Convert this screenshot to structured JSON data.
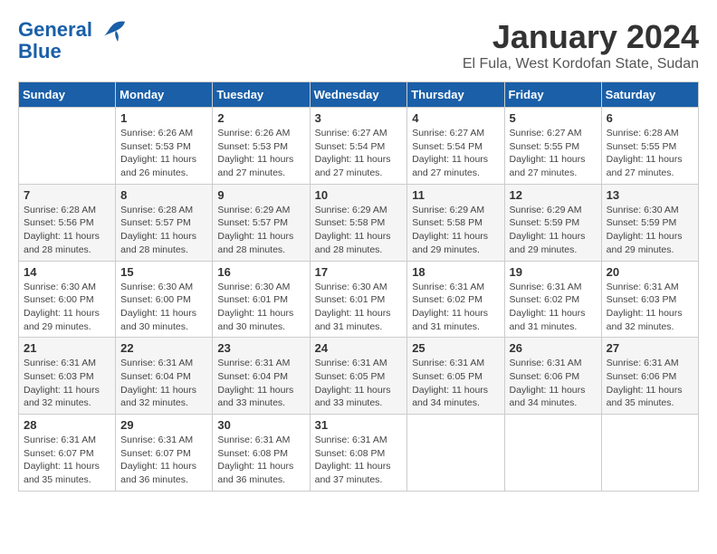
{
  "header": {
    "logo_line1": "General",
    "logo_line2": "Blue",
    "month_title": "January 2024",
    "location": "El Fula, West Kordofan State, Sudan"
  },
  "days_of_week": [
    "Sunday",
    "Monday",
    "Tuesday",
    "Wednesday",
    "Thursday",
    "Friday",
    "Saturday"
  ],
  "weeks": [
    [
      {
        "day": "",
        "sunrise": "",
        "sunset": "",
        "daylight": ""
      },
      {
        "day": "1",
        "sunrise": "Sunrise: 6:26 AM",
        "sunset": "Sunset: 5:53 PM",
        "daylight": "Daylight: 11 hours and 26 minutes."
      },
      {
        "day": "2",
        "sunrise": "Sunrise: 6:26 AM",
        "sunset": "Sunset: 5:53 PM",
        "daylight": "Daylight: 11 hours and 27 minutes."
      },
      {
        "day": "3",
        "sunrise": "Sunrise: 6:27 AM",
        "sunset": "Sunset: 5:54 PM",
        "daylight": "Daylight: 11 hours and 27 minutes."
      },
      {
        "day": "4",
        "sunrise": "Sunrise: 6:27 AM",
        "sunset": "Sunset: 5:54 PM",
        "daylight": "Daylight: 11 hours and 27 minutes."
      },
      {
        "day": "5",
        "sunrise": "Sunrise: 6:27 AM",
        "sunset": "Sunset: 5:55 PM",
        "daylight": "Daylight: 11 hours and 27 minutes."
      },
      {
        "day": "6",
        "sunrise": "Sunrise: 6:28 AM",
        "sunset": "Sunset: 5:55 PM",
        "daylight": "Daylight: 11 hours and 27 minutes."
      }
    ],
    [
      {
        "day": "7",
        "sunrise": "Sunrise: 6:28 AM",
        "sunset": "Sunset: 5:56 PM",
        "daylight": "Daylight: 11 hours and 28 minutes."
      },
      {
        "day": "8",
        "sunrise": "Sunrise: 6:28 AM",
        "sunset": "Sunset: 5:57 PM",
        "daylight": "Daylight: 11 hours and 28 minutes."
      },
      {
        "day": "9",
        "sunrise": "Sunrise: 6:29 AM",
        "sunset": "Sunset: 5:57 PM",
        "daylight": "Daylight: 11 hours and 28 minutes."
      },
      {
        "day": "10",
        "sunrise": "Sunrise: 6:29 AM",
        "sunset": "Sunset: 5:58 PM",
        "daylight": "Daylight: 11 hours and 28 minutes."
      },
      {
        "day": "11",
        "sunrise": "Sunrise: 6:29 AM",
        "sunset": "Sunset: 5:58 PM",
        "daylight": "Daylight: 11 hours and 29 minutes."
      },
      {
        "day": "12",
        "sunrise": "Sunrise: 6:29 AM",
        "sunset": "Sunset: 5:59 PM",
        "daylight": "Daylight: 11 hours and 29 minutes."
      },
      {
        "day": "13",
        "sunrise": "Sunrise: 6:30 AM",
        "sunset": "Sunset: 5:59 PM",
        "daylight": "Daylight: 11 hours and 29 minutes."
      }
    ],
    [
      {
        "day": "14",
        "sunrise": "Sunrise: 6:30 AM",
        "sunset": "Sunset: 6:00 PM",
        "daylight": "Daylight: 11 hours and 29 minutes."
      },
      {
        "day": "15",
        "sunrise": "Sunrise: 6:30 AM",
        "sunset": "Sunset: 6:00 PM",
        "daylight": "Daylight: 11 hours and 30 minutes."
      },
      {
        "day": "16",
        "sunrise": "Sunrise: 6:30 AM",
        "sunset": "Sunset: 6:01 PM",
        "daylight": "Daylight: 11 hours and 30 minutes."
      },
      {
        "day": "17",
        "sunrise": "Sunrise: 6:30 AM",
        "sunset": "Sunset: 6:01 PM",
        "daylight": "Daylight: 11 hours and 31 minutes."
      },
      {
        "day": "18",
        "sunrise": "Sunrise: 6:31 AM",
        "sunset": "Sunset: 6:02 PM",
        "daylight": "Daylight: 11 hours and 31 minutes."
      },
      {
        "day": "19",
        "sunrise": "Sunrise: 6:31 AM",
        "sunset": "Sunset: 6:02 PM",
        "daylight": "Daylight: 11 hours and 31 minutes."
      },
      {
        "day": "20",
        "sunrise": "Sunrise: 6:31 AM",
        "sunset": "Sunset: 6:03 PM",
        "daylight": "Daylight: 11 hours and 32 minutes."
      }
    ],
    [
      {
        "day": "21",
        "sunrise": "Sunrise: 6:31 AM",
        "sunset": "Sunset: 6:03 PM",
        "daylight": "Daylight: 11 hours and 32 minutes."
      },
      {
        "day": "22",
        "sunrise": "Sunrise: 6:31 AM",
        "sunset": "Sunset: 6:04 PM",
        "daylight": "Daylight: 11 hours and 32 minutes."
      },
      {
        "day": "23",
        "sunrise": "Sunrise: 6:31 AM",
        "sunset": "Sunset: 6:04 PM",
        "daylight": "Daylight: 11 hours and 33 minutes."
      },
      {
        "day": "24",
        "sunrise": "Sunrise: 6:31 AM",
        "sunset": "Sunset: 6:05 PM",
        "daylight": "Daylight: 11 hours and 33 minutes."
      },
      {
        "day": "25",
        "sunrise": "Sunrise: 6:31 AM",
        "sunset": "Sunset: 6:05 PM",
        "daylight": "Daylight: 11 hours and 34 minutes."
      },
      {
        "day": "26",
        "sunrise": "Sunrise: 6:31 AM",
        "sunset": "Sunset: 6:06 PM",
        "daylight": "Daylight: 11 hours and 34 minutes."
      },
      {
        "day": "27",
        "sunrise": "Sunrise: 6:31 AM",
        "sunset": "Sunset: 6:06 PM",
        "daylight": "Daylight: 11 hours and 35 minutes."
      }
    ],
    [
      {
        "day": "28",
        "sunrise": "Sunrise: 6:31 AM",
        "sunset": "Sunset: 6:07 PM",
        "daylight": "Daylight: 11 hours and 35 minutes."
      },
      {
        "day": "29",
        "sunrise": "Sunrise: 6:31 AM",
        "sunset": "Sunset: 6:07 PM",
        "daylight": "Daylight: 11 hours and 36 minutes."
      },
      {
        "day": "30",
        "sunrise": "Sunrise: 6:31 AM",
        "sunset": "Sunset: 6:08 PM",
        "daylight": "Daylight: 11 hours and 36 minutes."
      },
      {
        "day": "31",
        "sunrise": "Sunrise: 6:31 AM",
        "sunset": "Sunset: 6:08 PM",
        "daylight": "Daylight: 11 hours and 37 minutes."
      },
      {
        "day": "",
        "sunrise": "",
        "sunset": "",
        "daylight": ""
      },
      {
        "day": "",
        "sunrise": "",
        "sunset": "",
        "daylight": ""
      },
      {
        "day": "",
        "sunrise": "",
        "sunset": "",
        "daylight": ""
      }
    ]
  ]
}
